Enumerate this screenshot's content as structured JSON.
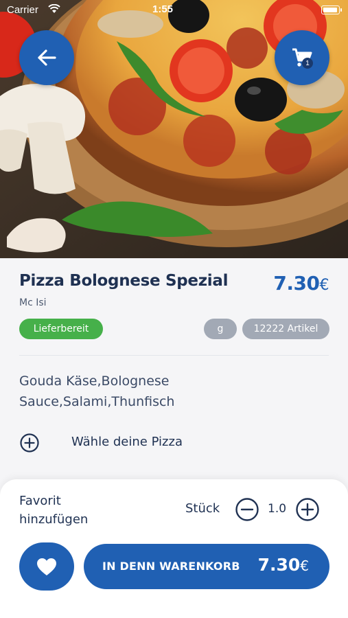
{
  "status_bar": {
    "carrier": "Carrier",
    "time": "1:55"
  },
  "hero": {
    "image": "pizza-photo"
  },
  "header": {
    "back_icon": "arrow-left-icon",
    "cart_icon": "cart-icon",
    "cart_count": "1"
  },
  "product": {
    "name": "Pizza Bolognese Spezial",
    "price": "7.30",
    "currency": "€",
    "vendor": "Mc Isi",
    "availability": "Lieferbereit",
    "unit": "g",
    "stock": "12222 Artikel",
    "description": "Gouda Käse,Bolognese Sauce,Salami,Thunfisch",
    "choose_label": "Wähle deine Pizza"
  },
  "footer": {
    "favorite_label": "Favorit hinzufügen",
    "quantity_label": "Stück",
    "quantity_value": "1.0",
    "add_to_cart_label": "IN DENN WARENKORB",
    "total_price": "7.30",
    "currency": "€"
  },
  "colors": {
    "primary": "#2060b3",
    "text_dark": "#1f3152",
    "available_green": "#46b04a",
    "pill_grey": "#a2a9b5"
  }
}
